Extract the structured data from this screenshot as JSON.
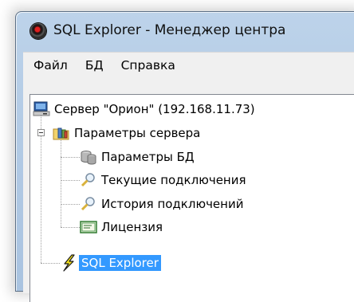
{
  "window": {
    "title": "SQL Explorer - Менеджер центра"
  },
  "menu": {
    "items": [
      "Файл",
      "БД",
      "Справка"
    ]
  },
  "tree": {
    "server": {
      "label": "Сервер \"Орион\" (192.168.11.73)",
      "icon": "server-icon"
    },
    "params": {
      "label": "Параметры сервера",
      "icon": "settings-folder-icon",
      "expanded": true
    },
    "children": [
      {
        "label": "Параметры БД",
        "icon": "database-icon"
      },
      {
        "label": "Текущие подключения",
        "icon": "magnifier-icon"
      },
      {
        "label": "История подключений",
        "icon": "magnifier-icon"
      },
      {
        "label": "Лицензия",
        "icon": "license-icon"
      }
    ],
    "sql_explorer": {
      "label": "SQL Explorer",
      "icon": "lightning-icon",
      "selected": true
    }
  }
}
